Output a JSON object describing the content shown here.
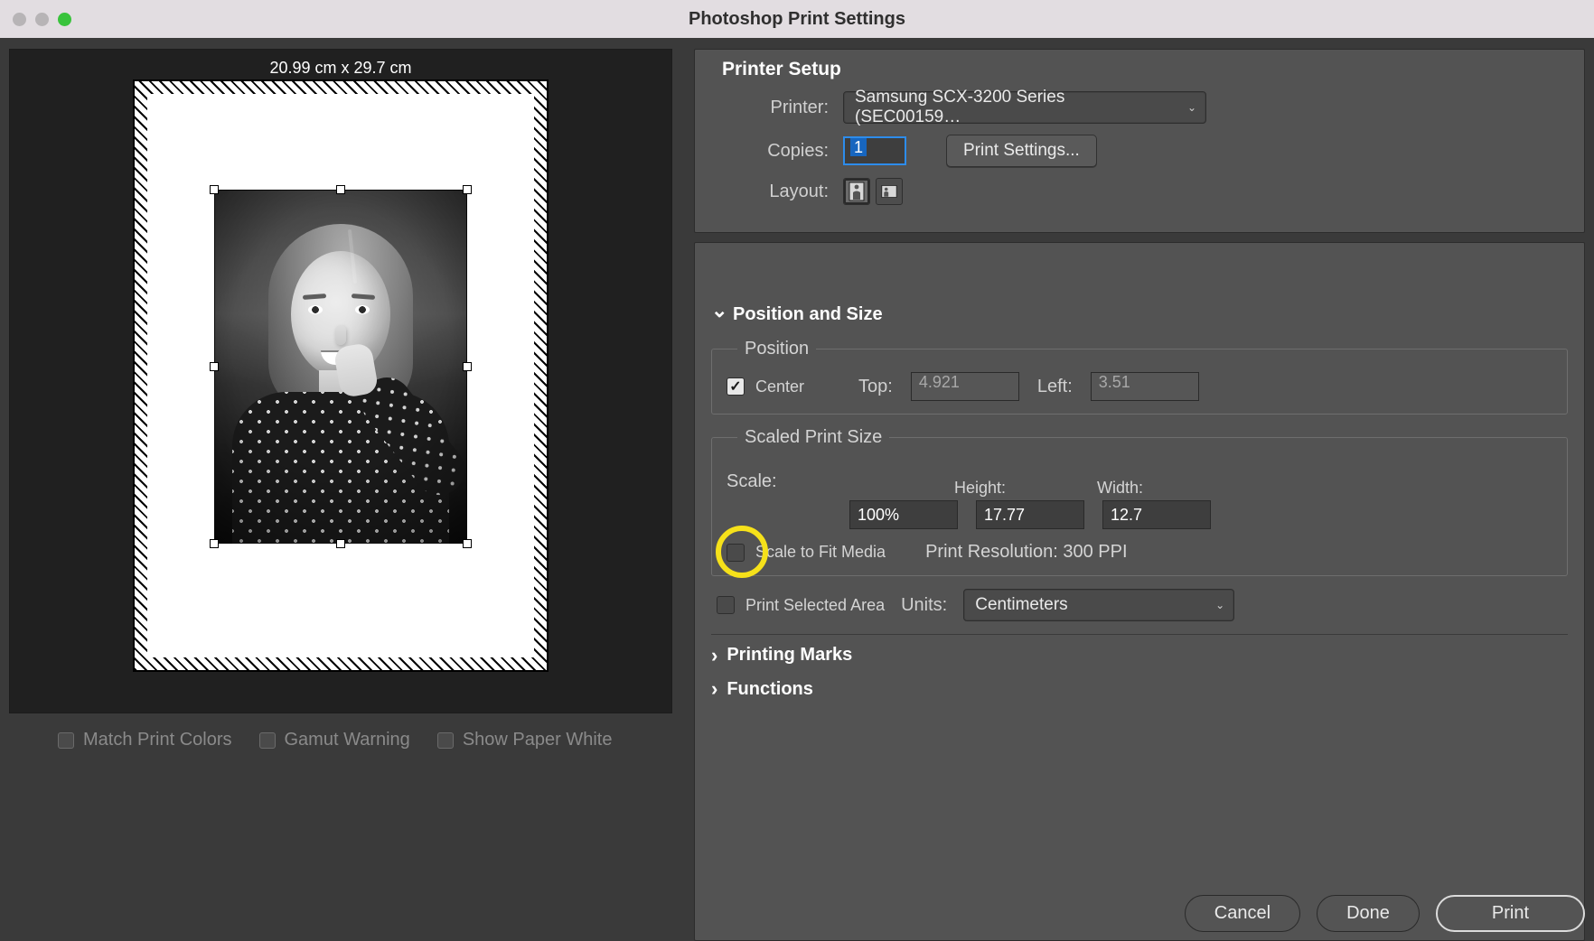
{
  "window": {
    "title": "Photoshop Print Settings"
  },
  "preview": {
    "dimensions": "20.99 cm x 29.7 cm"
  },
  "bottom_checks": {
    "match": "Match Print Colors",
    "gamut": "Gamut Warning",
    "white": "Show Paper White"
  },
  "printer_setup": {
    "heading": "Printer Setup",
    "printer_label": "Printer:",
    "printer_value": "Samsung SCX-3200 Series (SEC00159…",
    "copies_label": "Copies:",
    "copies_value": "1",
    "print_settings_btn": "Print Settings...",
    "layout_label": "Layout:"
  },
  "position_size": {
    "heading": "Position and Size",
    "position_legend": "Position",
    "center_label": "Center",
    "center_checked": true,
    "top_label": "Top:",
    "top_value": "4.921",
    "left_label": "Left:",
    "left_value": "3.51",
    "scaled_legend": "Scaled Print Size",
    "scale_label": "Scale:",
    "scale_value": "100%",
    "height_label": "Height:",
    "height_value": "17.77",
    "width_label": "Width:",
    "width_value": "12.7",
    "fit_label": "Scale to Fit Media",
    "fit_checked": false,
    "resolution_text": "Print Resolution: 300 PPI",
    "print_selected_label": "Print Selected Area",
    "print_selected_checked": false,
    "units_label": "Units:",
    "units_value": "Centimeters"
  },
  "sections": {
    "printing_marks": "Printing Marks",
    "functions": "Functions"
  },
  "buttons": {
    "cancel": "Cancel",
    "done": "Done",
    "print": "Print"
  }
}
